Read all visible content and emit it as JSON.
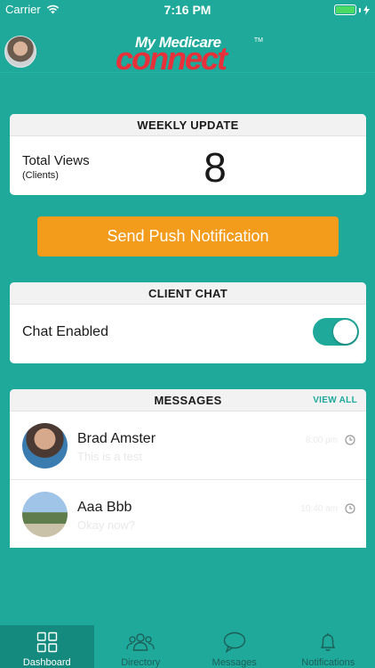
{
  "status_bar": {
    "carrier": "Carrier",
    "time": "7:16 PM"
  },
  "header": {
    "logo_top": "My Medicare",
    "logo_main": "connect",
    "logo_tm": "TM"
  },
  "weekly_update": {
    "title": "WEEKLY UPDATE",
    "label": "Total Views",
    "sublabel": "(Clients)",
    "count": "8"
  },
  "push_button": {
    "label": "Send Push Notification"
  },
  "client_chat": {
    "title": "CLIENT CHAT",
    "label": "Chat Enabled",
    "enabled": true
  },
  "messages": {
    "title": "MESSAGES",
    "view_all": "VIEW ALL",
    "items": [
      {
        "name": "Brad Amster",
        "preview": "This is a test",
        "time": "8:00 pm"
      },
      {
        "name": "Aaa Bbb",
        "preview": "Okay now?",
        "time": "10:40 am"
      }
    ]
  },
  "tabs": [
    {
      "label": "Dashboard",
      "icon": "grid-icon",
      "active": true
    },
    {
      "label": "Directory",
      "icon": "people-icon",
      "active": false
    },
    {
      "label": "Messages",
      "icon": "chat-bubble-icon",
      "active": false
    },
    {
      "label": "Notifications",
      "icon": "bell-icon",
      "active": false
    }
  ],
  "colors": {
    "teal": "#1fa99a",
    "orange": "#f39b1a",
    "logo_red": "#e8303a"
  }
}
